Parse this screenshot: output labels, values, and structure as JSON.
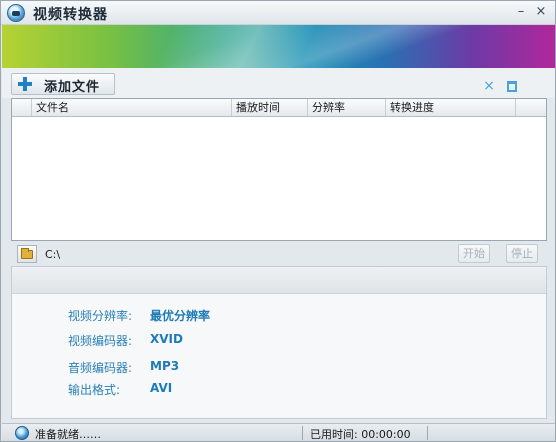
{
  "window": {
    "title": "视频转换器",
    "minimize_icon": "–",
    "close_icon": "×"
  },
  "toolbar": {
    "add_file_label": "添加文件",
    "remove_icon": "×"
  },
  "file_list": {
    "columns": [
      "文件名",
      "播放时间",
      "分辨率",
      "转换进度"
    ],
    "rows": []
  },
  "path_bar": {
    "path": "C:\\",
    "start_label": "开始",
    "stop_label": "停止"
  },
  "settings": {
    "resolution_label": "视频分辨率:",
    "resolution_value": "最优分辨率",
    "video_codec_label": "视频编码器:",
    "video_codec_value": "XVID",
    "audio_codec_label": "音频编码器:",
    "audio_codec_value": "MP3",
    "output_format_label": "输出格式:",
    "output_format_value": "AVI"
  },
  "status": {
    "state": "准备就绪……",
    "elapsed": "已用时间: 00:00:00"
  },
  "colors": {
    "accent": "#1f7bb6",
    "label_blue": "#2b80b6"
  }
}
